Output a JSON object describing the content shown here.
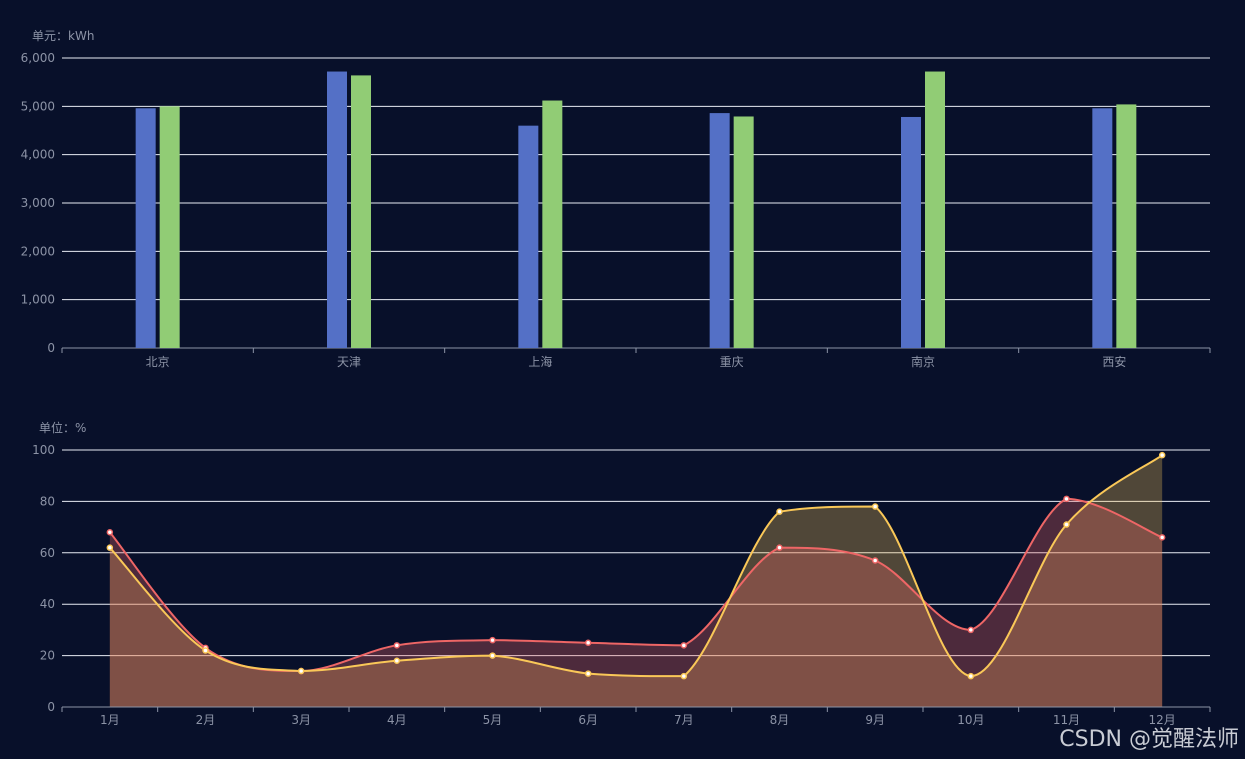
{
  "watermark": "CSDN @觉醒法师",
  "colors": {
    "background": "#08102a",
    "series_blue": "#5470c6",
    "series_green": "#91cc75",
    "series_red": "#ee6666",
    "series_yellow": "#fac858"
  },
  "chart_data": [
    {
      "type": "bar",
      "unit_label": "单元：kWh",
      "categories": [
        "北京",
        "天津",
        "上海",
        "重庆",
        "南京",
        "西安"
      ],
      "series": [
        {
          "color": "#5470c6",
          "values": [
            4960,
            5720,
            4600,
            4860,
            4780,
            4960
          ]
        },
        {
          "color": "#91cc75",
          "values": [
            5000,
            5640,
            5120,
            4790,
            5720,
            5040
          ]
        }
      ],
      "ylim": [
        0,
        6000
      ],
      "yticks": [
        "0",
        "1,000",
        "2,000",
        "3,000",
        "4,000",
        "5,000",
        "6,000"
      ],
      "ytick_values": [
        0,
        1000,
        2000,
        3000,
        4000,
        5000,
        6000
      ],
      "grid": true
    },
    {
      "type": "area",
      "unit_label": "单位：%",
      "categories": [
        "1月",
        "2月",
        "3月",
        "4月",
        "5月",
        "6月",
        "7月",
        "8月",
        "9月",
        "10月",
        "11月",
        "12月"
      ],
      "series": [
        {
          "color": "#ee6666",
          "values": [
            68,
            23,
            14,
            24,
            26,
            25,
            24,
            62,
            57,
            30,
            81,
            66
          ]
        },
        {
          "color": "#fac858",
          "values": [
            62,
            22,
            14,
            18,
            20,
            13,
            12,
            76,
            78,
            12,
            71,
            98
          ]
        }
      ],
      "ylim": [
        0,
        100
      ],
      "yticks": [
        "0",
        "20",
        "40",
        "60",
        "80",
        "100"
      ],
      "ytick_values": [
        0,
        20,
        40,
        60,
        80,
        100
      ],
      "smooth": true,
      "grid": true
    }
  ]
}
